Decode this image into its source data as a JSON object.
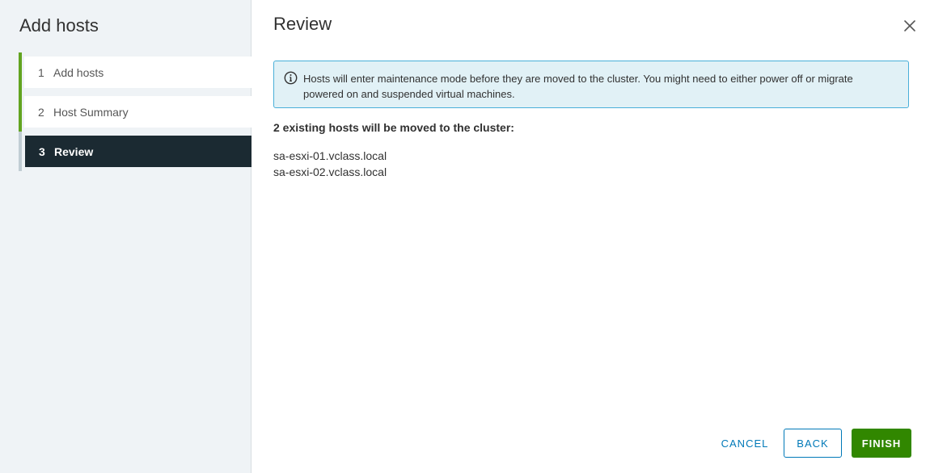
{
  "sidebar": {
    "title": "Add hosts",
    "steps": [
      {
        "number": "1",
        "label": "Add hosts",
        "state": "complete"
      },
      {
        "number": "2",
        "label": "Host Summary",
        "state": "complete"
      },
      {
        "number": "3",
        "label": "Review",
        "state": "current"
      }
    ]
  },
  "main": {
    "title": "Review",
    "close_icon": "close-icon",
    "alert": {
      "icon": "info-icon",
      "text": "Hosts will enter maintenance mode before they are moved to the cluster. You might need to either power off or migrate powered on and suspended virtual machines."
    },
    "heading": "2 existing hosts will be moved to the cluster:",
    "hosts": [
      "sa-esxi-01.vclass.local",
      "sa-esxi-02.vclass.local"
    ]
  },
  "footer": {
    "cancel_label": "CANCEL",
    "back_label": "BACK",
    "finish_label": "FINISH"
  },
  "colors": {
    "sidebar_bg": "#eff3f6",
    "step_complete_bar": "#62a420",
    "step_current_bg": "#1b2a32",
    "alert_bg": "#e1f1f6",
    "alert_border": "#49afd9",
    "link_blue": "#0079b8",
    "finish_green": "#318700"
  }
}
